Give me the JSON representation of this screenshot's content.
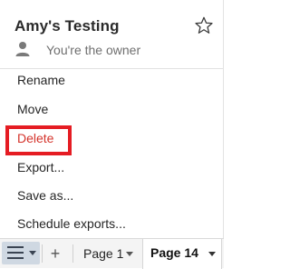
{
  "header": {
    "title": "Amy's Testing",
    "owner_text": "You're the owner"
  },
  "menu": {
    "items": [
      {
        "label": "Rename"
      },
      {
        "label": "Move"
      },
      {
        "label": "Delete"
      },
      {
        "label": "Export..."
      },
      {
        "label": "Save as..."
      },
      {
        "label": "Schedule exports..."
      }
    ]
  },
  "toolbar": {
    "add_label": "+",
    "tabs": [
      {
        "label": "Page 1"
      },
      {
        "label": "Page 14"
      }
    ]
  },
  "colors": {
    "danger_text": "#d4332b",
    "highlight_border": "#e51c23",
    "menu_toggle_bg": "#cfd8e2"
  },
  "icons": {
    "favorite": "star-icon",
    "owner": "person-icon",
    "menu": "hamburger-icon",
    "dropdown": "caret-down-icon"
  }
}
